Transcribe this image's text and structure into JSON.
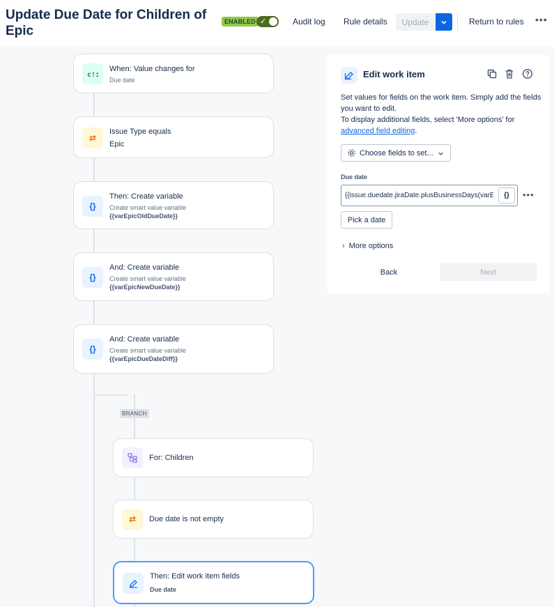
{
  "header": {
    "title": "Update Due Date for Children of Epic",
    "status_badge": "ENABLED",
    "audit_log": "Audit log",
    "rule_details": "Rule details",
    "update": "Update",
    "return_to_rules": "Return to rules",
    "more": "•••"
  },
  "flow": {
    "trigger": {
      "title": "When: Value changes for",
      "subtitle": "Due date",
      "icon": "trigger-icon"
    },
    "condition1": {
      "title": "Issue Type equals",
      "subtitle": "Epic",
      "icon": "swap-arrows-icon"
    },
    "action1": {
      "title": "Then: Create variable",
      "subtitle": "Create smart value variable",
      "detail": "{{varEpicOldDueDate}}",
      "icon": "braces-icon"
    },
    "action2": {
      "title": "And: Create variable",
      "subtitle": "Create smart value variable",
      "detail": "{{varEpicNewDueDate}}",
      "icon": "braces-icon"
    },
    "action3": {
      "title": "And: Create variable",
      "subtitle": "Create smart value variable",
      "detail": "{{varEpicDueDateDiff}}",
      "icon": "braces-icon"
    },
    "branch_label": "BRANCH",
    "branch": {
      "title": "For: Children",
      "icon": "hierarchy-icon"
    },
    "condition2": {
      "title": "Due date is not empty",
      "icon": "swap-arrows-icon"
    },
    "action4": {
      "title": "Then: Edit work item fields",
      "detail": "Due date",
      "icon": "edit-icon"
    }
  },
  "panel": {
    "title": "Edit work item",
    "desc1": "Set values for fields on the work item. Simply add the fields you want to edit.",
    "desc2": "To display additional fields, select 'More options' for",
    "desc_link": "advanced field editing",
    "desc_end": ".",
    "choose_fields": "Choose fields to set...",
    "field_label": "Due date",
    "field_value": "{{issue.duedate.jiraDate.plusBusinessDays(varEpicDueDateDiff.asNumber)}}",
    "smart_value_btn": "{}",
    "field_more": "•••",
    "pick_date": "Pick a date",
    "more_options": "More options",
    "back": "Back",
    "next": "Next"
  },
  "colors": {
    "accent": "#0c66e4",
    "badge": "#94c748",
    "toggle": "#4c6b1f",
    "selected_border": "#4c9aff"
  }
}
